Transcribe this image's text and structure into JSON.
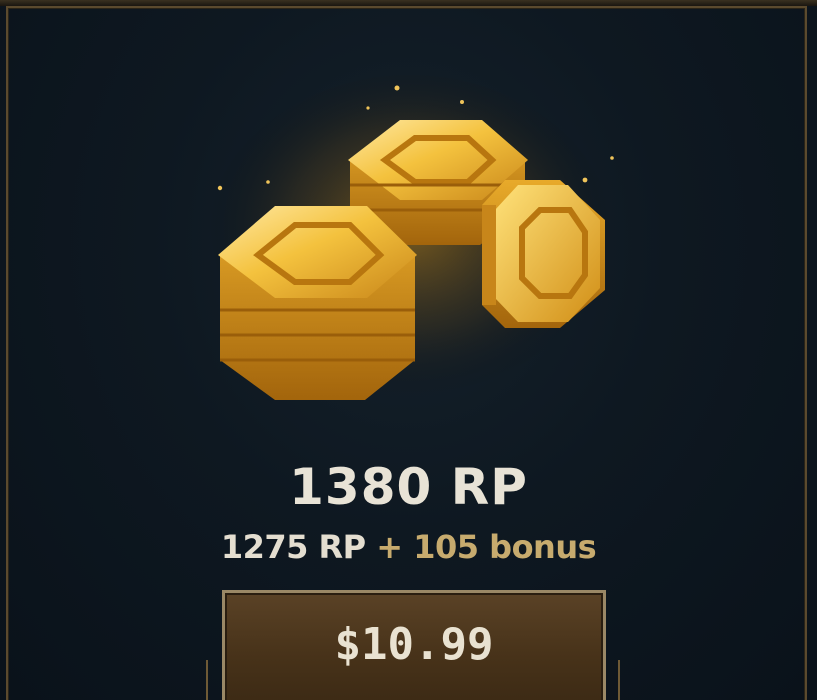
{
  "offer": {
    "total_amount": "1380 RP",
    "base_amount": "1275 RP",
    "bonus_amount": "+ 105 bonus",
    "price": "$10.99"
  },
  "colors": {
    "background": "#0e1821",
    "gold": "#e0a52a",
    "bonus_text": "#c7ab6e",
    "button_fill": "#4a341b",
    "button_border": "#9a8866"
  },
  "icons": {
    "illustration": "gold-hexagon-coins-icon"
  }
}
